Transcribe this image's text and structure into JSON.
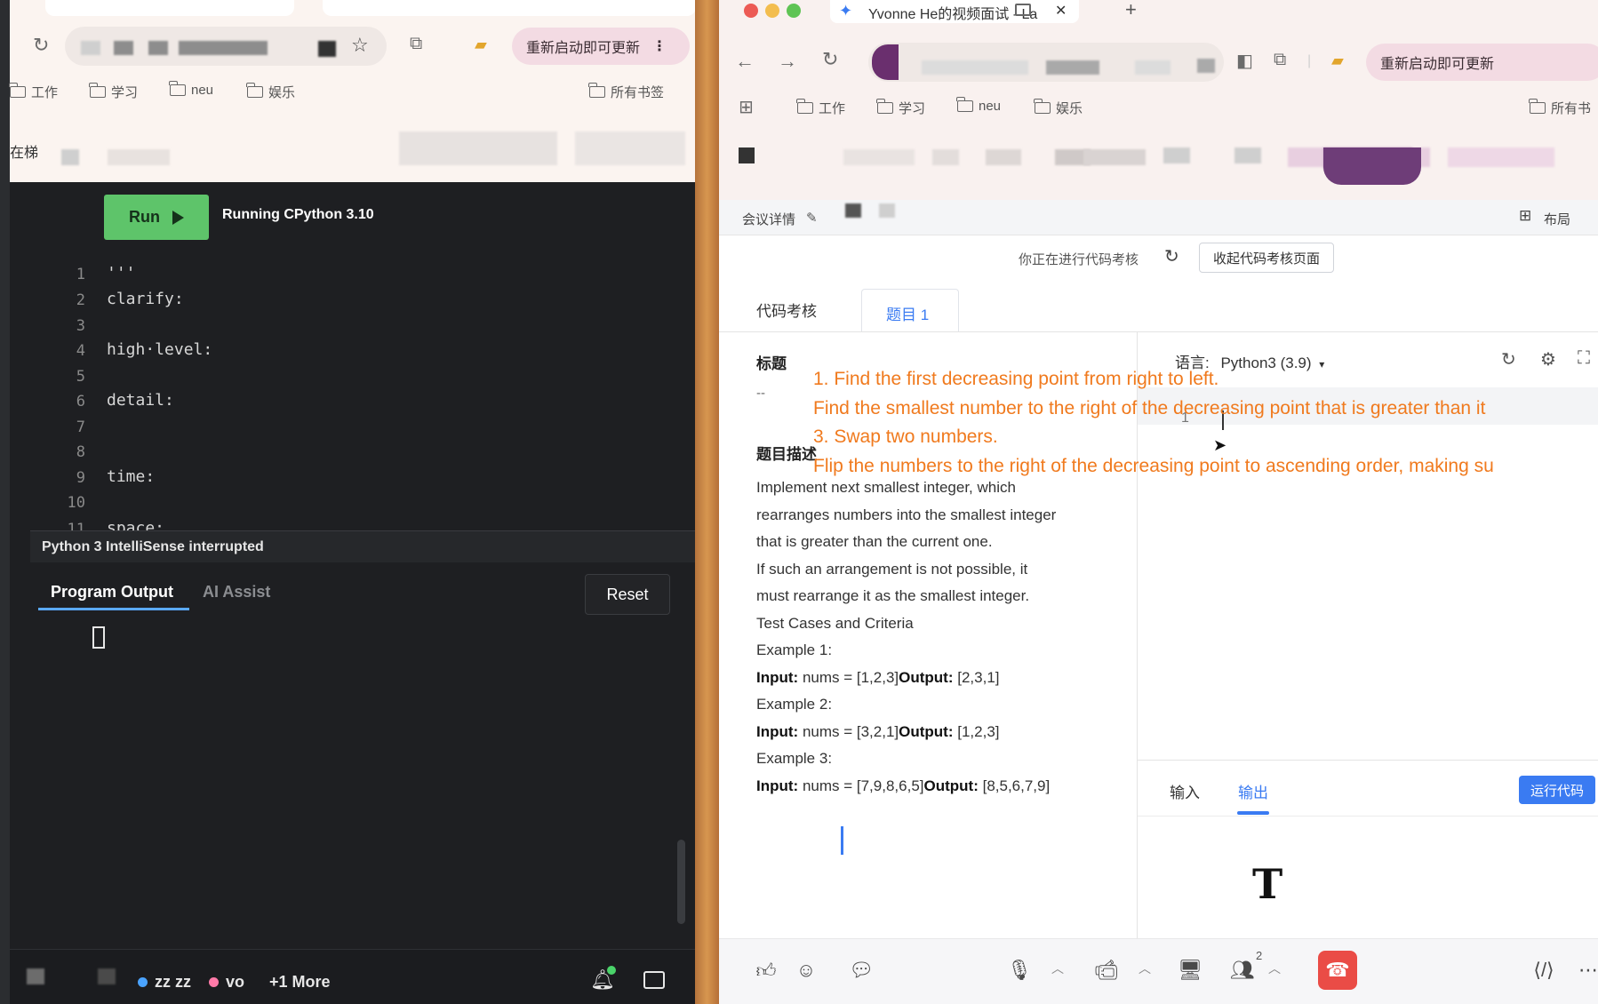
{
  "left_window": {
    "chrome": {
      "update_button": "重新启动即可更新",
      "bookmarks": [
        "工作",
        "学习",
        "neu",
        "娱乐"
      ],
      "all_bookmarks": "所有书签",
      "page_prefix": "在梯"
    },
    "editor": {
      "run_label": "Run",
      "running_status": "Running CPython 3.10",
      "lines": [
        {
          "n": "1",
          "text": "'''"
        },
        {
          "n": "2",
          "text": "clarify:"
        },
        {
          "n": "3",
          "text": ""
        },
        {
          "n": "4",
          "text": "high·level:"
        },
        {
          "n": "5",
          "text": ""
        },
        {
          "n": "6",
          "text": "detail:"
        },
        {
          "n": "7",
          "text": ""
        },
        {
          "n": "8",
          "text": ""
        },
        {
          "n": "9",
          "text": "time:"
        },
        {
          "n": "10",
          "text": ""
        },
        {
          "n": "11",
          "text": "space:"
        }
      ],
      "status_message": "Python 3 IntelliSense interrupted"
    },
    "output_panel": {
      "tab_output": "Program Output",
      "tab_ai": "AI Assist",
      "reset_label": "Reset"
    },
    "presence": {
      "user1": "zz zz",
      "user2": "vo",
      "more": "+1 More"
    },
    "colors": {
      "user1_dot": "#4aa3ff",
      "user2_dot": "#ff7aa8"
    }
  },
  "right_window": {
    "tab_title": "Yvonne He的视频面试 - La",
    "update_button": "重新启动即可更新",
    "bookmarks": [
      "工作",
      "学习",
      "neu",
      "娱乐"
    ],
    "all_bookmarks": "所有书",
    "meeting": {
      "details": "会议详情",
      "layout": "布局"
    },
    "review_status": "你正在进行代码考核",
    "collapse_button": "收起代码考核页面",
    "tabs": {
      "code_review": "代码考核",
      "question1": "题目 1"
    },
    "question": {
      "title_label": "标题",
      "title_value": "--",
      "desc_label": "题目描述",
      "desc_lines": [
        "Implement next smallest integer, which",
        "rearranges numbers into the smallest integer",
        "that is greater than the current one.",
        "If such an arrangement is not possible, it",
        "must rearrange it as the smallest integer.",
        "Test Cases and Criteria",
        "Example 1:"
      ],
      "examples": [
        {
          "input": "nums = [1,2,3]",
          "output": "[2,3,1]"
        },
        {
          "label": "Example 2:",
          "input": "nums = [3,2,1]",
          "output": "[1,2,3]"
        },
        {
          "label": "Example 3:",
          "input": "nums = [7,9,8,6,5]",
          "output": "[8,5,6,7,9]"
        }
      ],
      "input_label": "Input:",
      "output_label": "Output:"
    },
    "overlay_notes": [
      "1. Find the first decreasing point from right to left.",
      "Find the smallest number to the right of the decreasing point that is greater than it",
      "3. Swap two numbers.",
      "Flip the numbers to the right of the decreasing point to ascending order, making su"
    ],
    "editor": {
      "language_label": "语言:",
      "language_value": "Python3 (3.9)",
      "line_number": "1"
    },
    "io": {
      "input_tab": "输入",
      "output_tab": "输出",
      "run_code": "运行代码"
    },
    "participants_count": "2",
    "colors": {
      "accent": "#3a7bf2",
      "overlay": "#f07a1e",
      "hangup": "#ea4c46"
    }
  }
}
